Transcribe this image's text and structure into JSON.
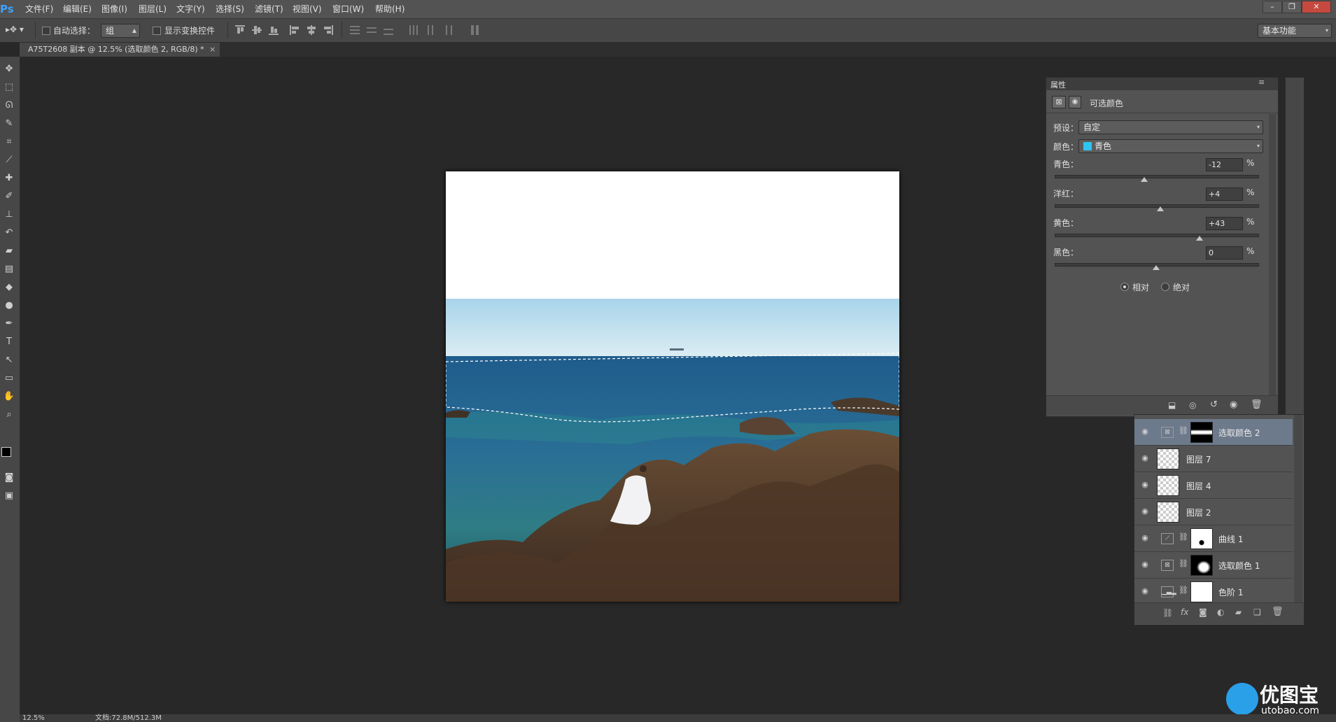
{
  "app": {
    "logo": "Ps"
  },
  "menu": [
    "文件(F)",
    "编辑(E)",
    "图像(I)",
    "图层(L)",
    "文字(Y)",
    "选择(S)",
    "滤镜(T)",
    "视图(V)",
    "窗口(W)",
    "帮助(H)"
  ],
  "options": {
    "auto_select_label": "自动选择：",
    "auto_select_value": "组",
    "show_transform_label": "显示变换控件",
    "workspace": "基本功能"
  },
  "document": {
    "tab_title": "A75T2608 副本 @ 12.5% (选取颜色 2, RGB/8) *",
    "close": "×"
  },
  "properties": {
    "panel_title": "属性",
    "adjustment_name": "可选颜色",
    "preset_label": "预设：",
    "preset_value": "自定",
    "color_label": "颜色：",
    "color_value": "青色",
    "color_swatch": "#2fc4f2",
    "sliders": [
      {
        "label": "青色：",
        "value": "-12",
        "unit": "%",
        "fraction": 0.44
      },
      {
        "label": "洋红：",
        "value": "+4",
        "unit": "%",
        "fraction": 0.52
      },
      {
        "label": "黄色：",
        "value": "+43",
        "unit": "%",
        "fraction": 0.715
      },
      {
        "label": "黑色：",
        "value": "0",
        "unit": "%",
        "fraction": 0.5
      }
    ],
    "radio_relative": "相对",
    "radio_absolute": "绝对"
  },
  "layers": [
    {
      "name": "选取颜色 2",
      "type": "adjustment",
      "selected": true,
      "mask": "band"
    },
    {
      "name": "图层 7",
      "type": "pixel",
      "selected": false
    },
    {
      "name": "图层 4",
      "type": "pixel",
      "selected": false
    },
    {
      "name": "图层 2",
      "type": "pixel",
      "selected": false
    },
    {
      "name": "曲线 1",
      "type": "adjustment",
      "selected": false,
      "mask": "dot"
    },
    {
      "name": "选取颜色 1",
      "type": "adjustment",
      "selected": false,
      "mask": "blob"
    },
    {
      "name": "色阶 1",
      "type": "adjustment",
      "selected": false,
      "mask": "white"
    }
  ],
  "status": {
    "zoom": "12.5%",
    "doc_size": "文档:72.8M/512.3M"
  },
  "watermark": {
    "brand": "优图宝",
    "site": "utobao.com"
  }
}
